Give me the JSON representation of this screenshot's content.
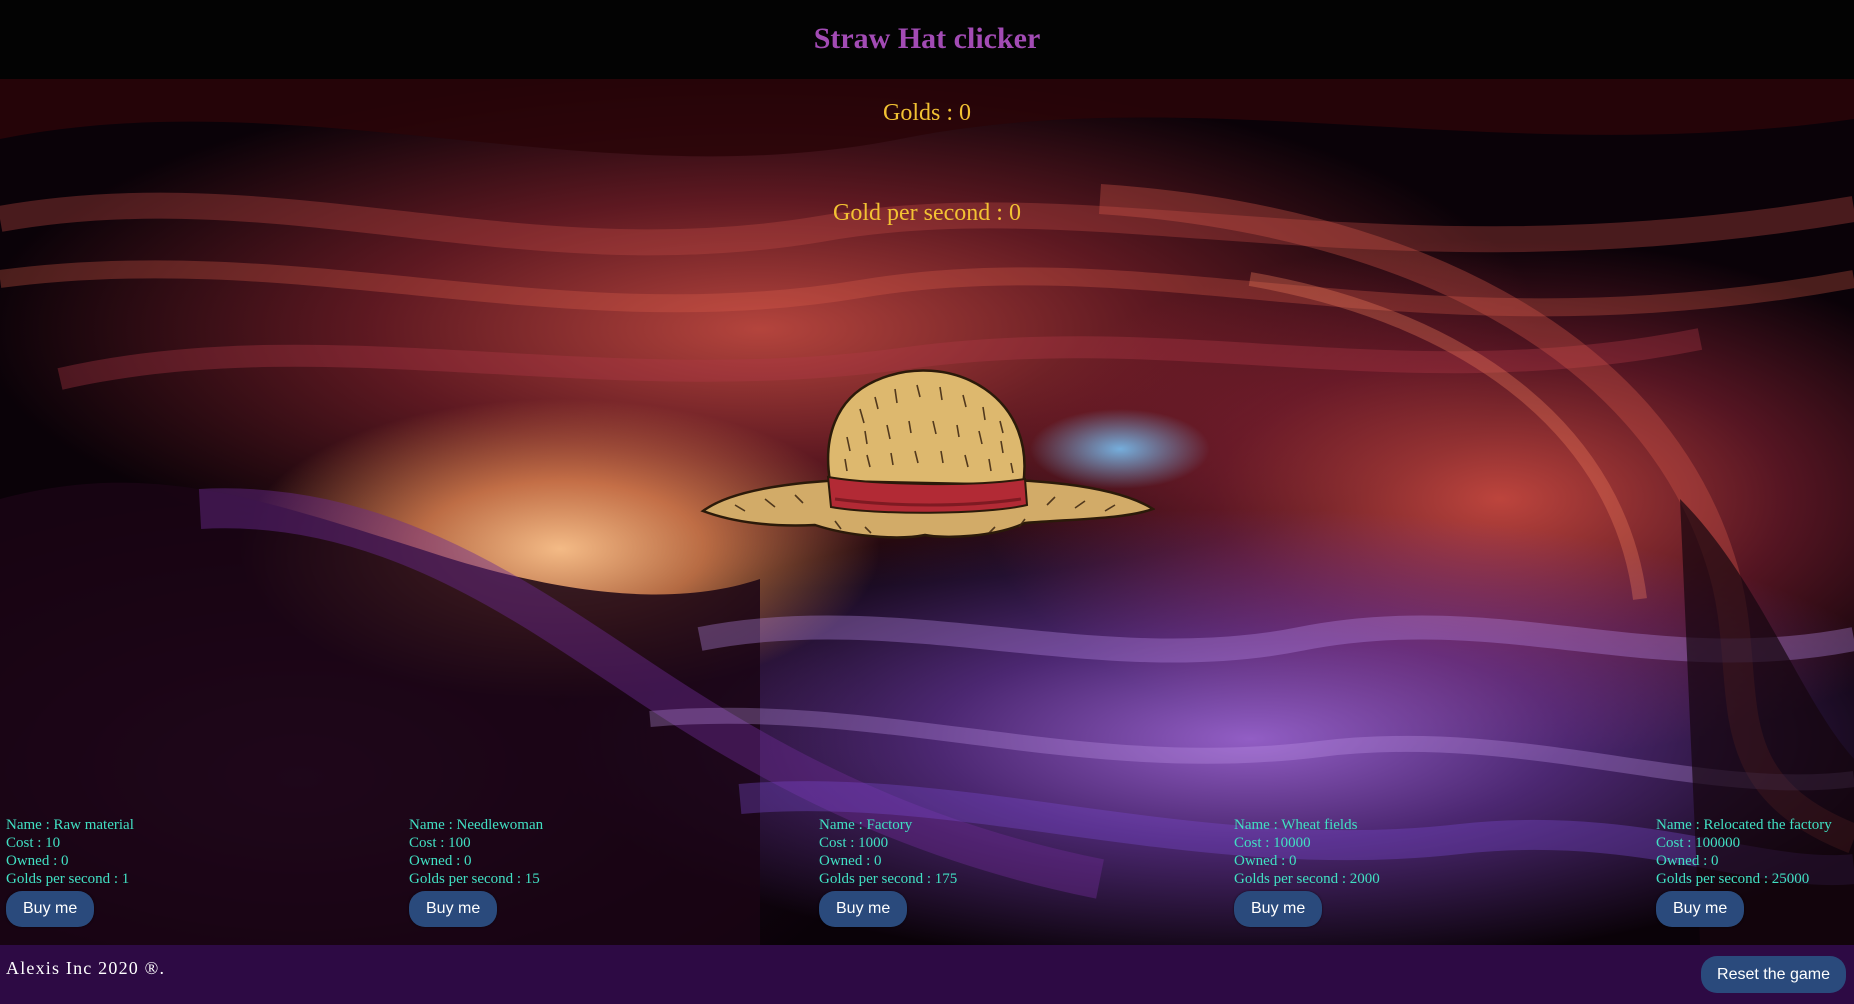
{
  "header": {
    "title": "Straw Hat clicker"
  },
  "stats": {
    "golds": "Golds : 0",
    "gold_per_second": "Gold per second : 0"
  },
  "clicker": {
    "icon": "straw-hat-icon"
  },
  "shop": {
    "items": [
      {
        "name": "Name : Raw material",
        "cost": "Cost : 10",
        "owned": "Owned : 0",
        "gps": "Golds per second : 1",
        "button": "Buy me"
      },
      {
        "name": "Name : Needlewoman",
        "cost": "Cost : 100",
        "owned": "Owned : 0",
        "gps": "Golds per second : 15",
        "button": "Buy me"
      },
      {
        "name": "Name : Factory",
        "cost": "Cost : 1000",
        "owned": "Owned : 0",
        "gps": "Golds per second : 175",
        "button": "Buy me"
      },
      {
        "name": "Name : Wheat fields",
        "cost": "Cost : 10000",
        "owned": "Owned : 0",
        "gps": "Golds per second : 2000",
        "button": "Buy me"
      },
      {
        "name": "Name : Relocated the factory",
        "cost": "Cost : 100000",
        "owned": "Owned : 0",
        "gps": "Golds per second : 25000",
        "button": "Buy me"
      }
    ]
  },
  "footer": {
    "copyright": "Alexis Inc 2020 ®.",
    "reset_label": "Reset the game"
  },
  "colors": {
    "title": "#a24bb4",
    "stats": "#f2c233",
    "shop_text": "#41e0c3",
    "button_bg": "#2a4a7c",
    "footer_bg": "#2d0a44"
  }
}
